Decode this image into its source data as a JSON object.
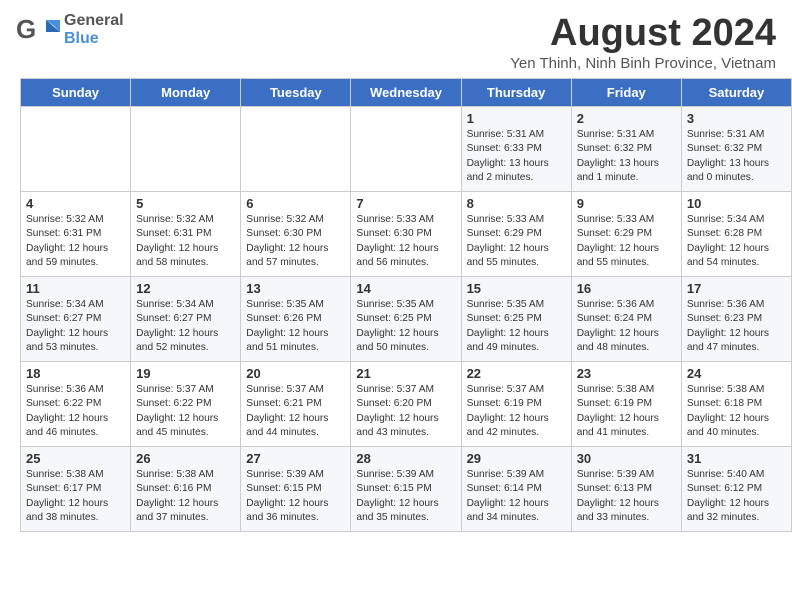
{
  "header": {
    "logo_general": "General",
    "logo_blue": "Blue",
    "month_title": "August 2024",
    "location": "Yen Thinh, Ninh Binh Province, Vietnam"
  },
  "calendar": {
    "days_of_week": [
      "Sunday",
      "Monday",
      "Tuesday",
      "Wednesday",
      "Thursday",
      "Friday",
      "Saturday"
    ],
    "weeks": [
      [
        {
          "day": "",
          "info": ""
        },
        {
          "day": "",
          "info": ""
        },
        {
          "day": "",
          "info": ""
        },
        {
          "day": "",
          "info": ""
        },
        {
          "day": "1",
          "info": "Sunrise: 5:31 AM\nSunset: 6:33 PM\nDaylight: 13 hours\nand 2 minutes."
        },
        {
          "day": "2",
          "info": "Sunrise: 5:31 AM\nSunset: 6:32 PM\nDaylight: 13 hours\nand 1 minute."
        },
        {
          "day": "3",
          "info": "Sunrise: 5:31 AM\nSunset: 6:32 PM\nDaylight: 13 hours\nand 0 minutes."
        }
      ],
      [
        {
          "day": "4",
          "info": "Sunrise: 5:32 AM\nSunset: 6:31 PM\nDaylight: 12 hours\nand 59 minutes."
        },
        {
          "day": "5",
          "info": "Sunrise: 5:32 AM\nSunset: 6:31 PM\nDaylight: 12 hours\nand 58 minutes."
        },
        {
          "day": "6",
          "info": "Sunrise: 5:32 AM\nSunset: 6:30 PM\nDaylight: 12 hours\nand 57 minutes."
        },
        {
          "day": "7",
          "info": "Sunrise: 5:33 AM\nSunset: 6:30 PM\nDaylight: 12 hours\nand 56 minutes."
        },
        {
          "day": "8",
          "info": "Sunrise: 5:33 AM\nSunset: 6:29 PM\nDaylight: 12 hours\nand 55 minutes."
        },
        {
          "day": "9",
          "info": "Sunrise: 5:33 AM\nSunset: 6:29 PM\nDaylight: 12 hours\nand 55 minutes."
        },
        {
          "day": "10",
          "info": "Sunrise: 5:34 AM\nSunset: 6:28 PM\nDaylight: 12 hours\nand 54 minutes."
        }
      ],
      [
        {
          "day": "11",
          "info": "Sunrise: 5:34 AM\nSunset: 6:27 PM\nDaylight: 12 hours\nand 53 minutes."
        },
        {
          "day": "12",
          "info": "Sunrise: 5:34 AM\nSunset: 6:27 PM\nDaylight: 12 hours\nand 52 minutes."
        },
        {
          "day": "13",
          "info": "Sunrise: 5:35 AM\nSunset: 6:26 PM\nDaylight: 12 hours\nand 51 minutes."
        },
        {
          "day": "14",
          "info": "Sunrise: 5:35 AM\nSunset: 6:25 PM\nDaylight: 12 hours\nand 50 minutes."
        },
        {
          "day": "15",
          "info": "Sunrise: 5:35 AM\nSunset: 6:25 PM\nDaylight: 12 hours\nand 49 minutes."
        },
        {
          "day": "16",
          "info": "Sunrise: 5:36 AM\nSunset: 6:24 PM\nDaylight: 12 hours\nand 48 minutes."
        },
        {
          "day": "17",
          "info": "Sunrise: 5:36 AM\nSunset: 6:23 PM\nDaylight: 12 hours\nand 47 minutes."
        }
      ],
      [
        {
          "day": "18",
          "info": "Sunrise: 5:36 AM\nSunset: 6:22 PM\nDaylight: 12 hours\nand 46 minutes."
        },
        {
          "day": "19",
          "info": "Sunrise: 5:37 AM\nSunset: 6:22 PM\nDaylight: 12 hours\nand 45 minutes."
        },
        {
          "day": "20",
          "info": "Sunrise: 5:37 AM\nSunset: 6:21 PM\nDaylight: 12 hours\nand 44 minutes."
        },
        {
          "day": "21",
          "info": "Sunrise: 5:37 AM\nSunset: 6:20 PM\nDaylight: 12 hours\nand 43 minutes."
        },
        {
          "day": "22",
          "info": "Sunrise: 5:37 AM\nSunset: 6:19 PM\nDaylight: 12 hours\nand 42 minutes."
        },
        {
          "day": "23",
          "info": "Sunrise: 5:38 AM\nSunset: 6:19 PM\nDaylight: 12 hours\nand 41 minutes."
        },
        {
          "day": "24",
          "info": "Sunrise: 5:38 AM\nSunset: 6:18 PM\nDaylight: 12 hours\nand 40 minutes."
        }
      ],
      [
        {
          "day": "25",
          "info": "Sunrise: 5:38 AM\nSunset: 6:17 PM\nDaylight: 12 hours\nand 38 minutes."
        },
        {
          "day": "26",
          "info": "Sunrise: 5:38 AM\nSunset: 6:16 PM\nDaylight: 12 hours\nand 37 minutes."
        },
        {
          "day": "27",
          "info": "Sunrise: 5:39 AM\nSunset: 6:15 PM\nDaylight: 12 hours\nand 36 minutes."
        },
        {
          "day": "28",
          "info": "Sunrise: 5:39 AM\nSunset: 6:15 PM\nDaylight: 12 hours\nand 35 minutes."
        },
        {
          "day": "29",
          "info": "Sunrise: 5:39 AM\nSunset: 6:14 PM\nDaylight: 12 hours\nand 34 minutes."
        },
        {
          "day": "30",
          "info": "Sunrise: 5:39 AM\nSunset: 6:13 PM\nDaylight: 12 hours\nand 33 minutes."
        },
        {
          "day": "31",
          "info": "Sunrise: 5:40 AM\nSunset: 6:12 PM\nDaylight: 12 hours\nand 32 minutes."
        }
      ]
    ]
  }
}
